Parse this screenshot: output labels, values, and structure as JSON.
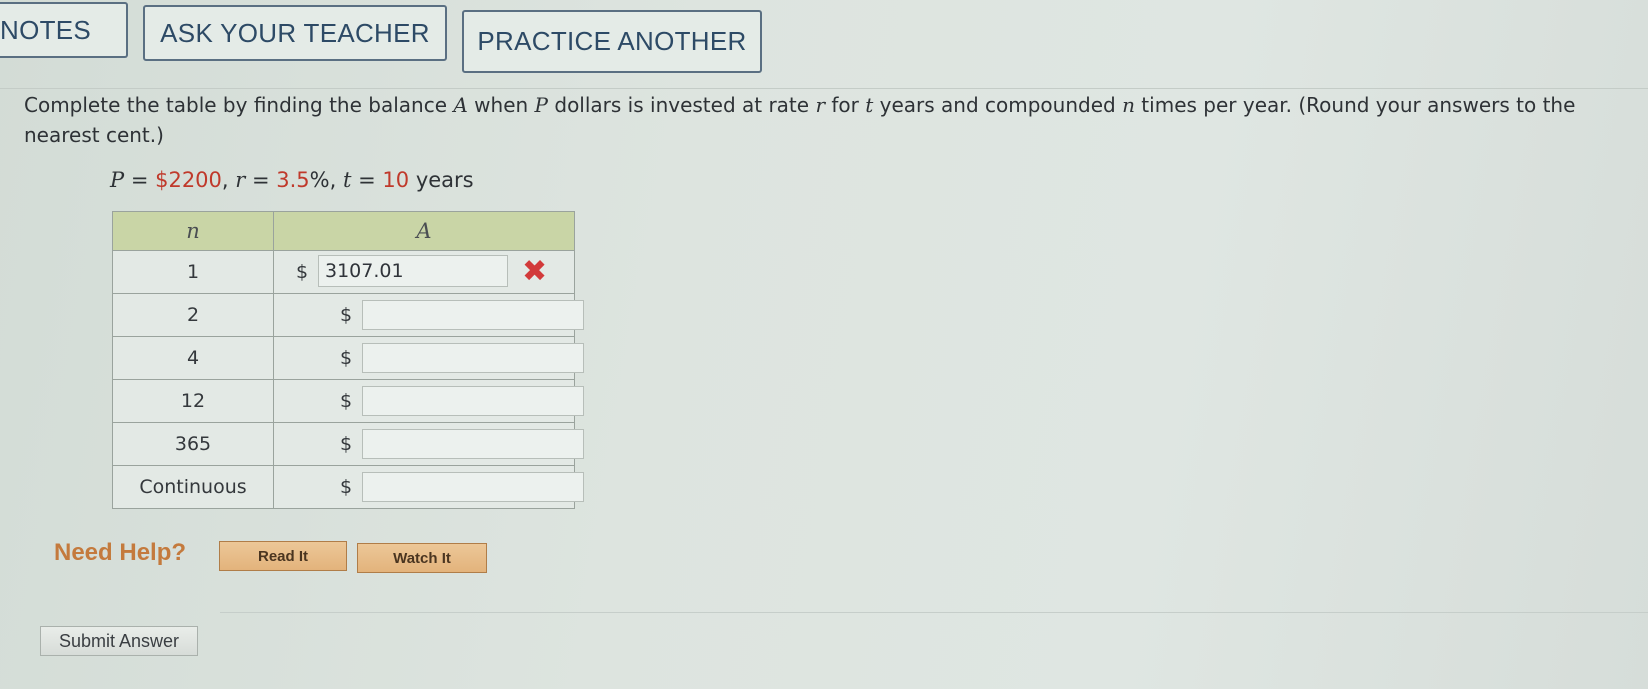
{
  "toolbar": {
    "notes_label": "NOTES",
    "ask_teacher_label": "ASK YOUR TEACHER",
    "practice_label": "PRACTICE ANOTHER"
  },
  "question": {
    "text_1": "Complete the table by finding the balance ",
    "var_A": "A",
    "text_2": " when ",
    "var_P": "P",
    "text_3": " dollars is invested at rate ",
    "var_r": "r",
    "text_4": " for ",
    "var_t": "t",
    "text_5": " years and compounded ",
    "var_n": "n",
    "text_6": " times per year. (Round your answers to the nearest cent.)"
  },
  "params": {
    "p_label": "P",
    "p_eq": " = ",
    "p_value": "$2200",
    "r_label": "r",
    "r_eq": " = ",
    "r_value": "3.5",
    "r_unit": "%",
    "t_label": "t",
    "t_eq": " = ",
    "t_value": "10",
    "t_unit": " years"
  },
  "table": {
    "header_n": "n",
    "header_a": "A",
    "rows": [
      {
        "n": "1",
        "currency": "$",
        "answer": "3107.01",
        "status": "incorrect"
      },
      {
        "n": "2",
        "currency": "$",
        "answer": ""
      },
      {
        "n": "4",
        "currency": "$",
        "answer": ""
      },
      {
        "n": "12",
        "currency": "$",
        "answer": ""
      },
      {
        "n": "365",
        "currency": "$",
        "answer": ""
      },
      {
        "n": "Continuous",
        "currency": "$",
        "answer": ""
      }
    ]
  },
  "help": {
    "label": "Need Help?",
    "read_label": "Read It",
    "watch_label": "Watch It"
  },
  "submit_label": "Submit Answer",
  "colors": {
    "header_fill": "#c9d5a6",
    "incorrect_mark": "#d23a3a",
    "accent_red": "#c0392b",
    "help_orange": "#c47a3d"
  }
}
